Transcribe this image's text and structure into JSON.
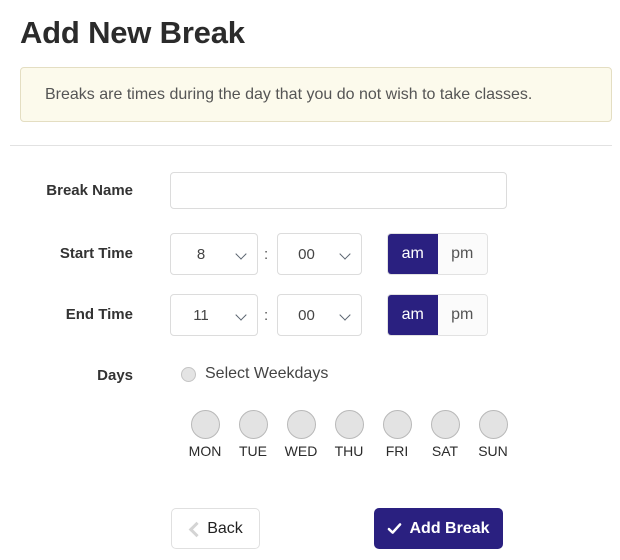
{
  "page": {
    "title": "Add New Break"
  },
  "banner": {
    "message": "Breaks are times during the day that you do not wish to take classes."
  },
  "form": {
    "break_name": {
      "label": "Break Name",
      "value": "",
      "placeholder": ""
    },
    "start_time": {
      "label": "Start Time",
      "hour": "8",
      "separator": ":",
      "minute": "00",
      "meridiem_selected": "am",
      "meridiem_options": [
        "am",
        "pm"
      ]
    },
    "end_time": {
      "label": "End Time",
      "hour": "11",
      "separator": ":",
      "minute": "00",
      "meridiem_selected": "am",
      "meridiem_options": [
        "am",
        "pm"
      ]
    },
    "days": {
      "label": "Days",
      "weekday_toggle_label": "Select Weekdays",
      "weekday_toggle_checked": false,
      "items": [
        {
          "name": "MON",
          "selected": false
        },
        {
          "name": "TUE",
          "selected": false
        },
        {
          "name": "WED",
          "selected": false
        },
        {
          "name": "THU",
          "selected": false
        },
        {
          "name": "FRI",
          "selected": false
        },
        {
          "name": "SAT",
          "selected": false
        },
        {
          "name": "SUN",
          "selected": false
        }
      ]
    }
  },
  "footer": {
    "back_label": "Back",
    "back_icon": "chevron-left-icon",
    "add_label": "Add Break",
    "add_icon": "check-icon"
  },
  "colors": {
    "accent": "#2a2080",
    "banner_background": "#fcfaec",
    "banner_border": "#e4dec2",
    "text": "#333333",
    "toggle_fill": "#e3e3e3"
  }
}
